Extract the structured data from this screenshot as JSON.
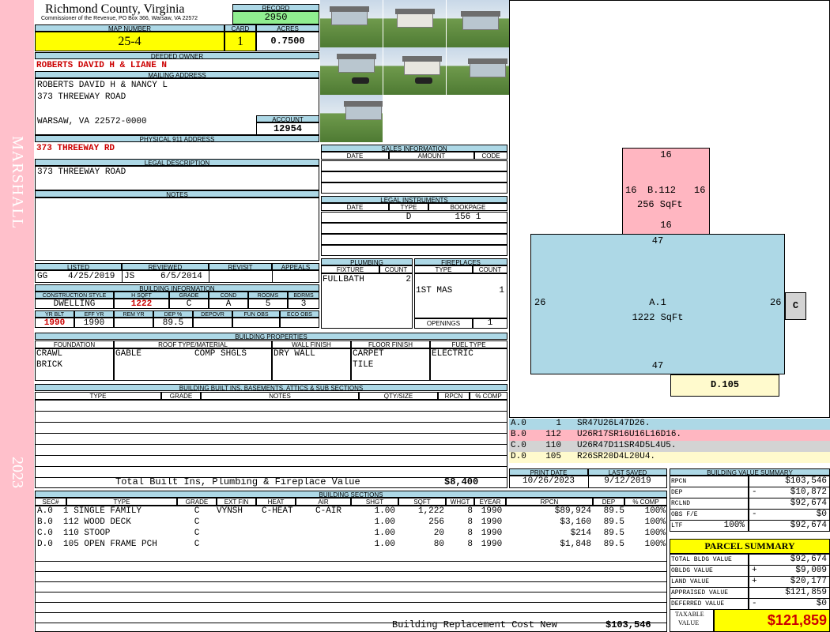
{
  "sidebar": {
    "district": "MARSHALL",
    "year": "2023"
  },
  "header": {
    "county": "Richmond County, Virginia",
    "commissioner": "Commissioner of the Revenue, PO Box 366, Warsaw, VA 22572",
    "record_label": "RECORD",
    "record": "2950",
    "map_label": "MAP NUMBER",
    "map_number": "25-4",
    "card_label": "CARD",
    "card": "1",
    "acres_label": "ACRES",
    "acres": "0.7500"
  },
  "owner": {
    "deeded_label": "DEEDED OWNER",
    "deeded": "ROBERTS DAVID H & LIANE N",
    "mailing_label": "MAILING ADDRESS",
    "mail1": "ROBERTS DAVID H & NANCY L",
    "mail2": "373 THREEWAY ROAD",
    "mail3": "WARSAW, VA 22572-0000",
    "account_label": "ACCOUNT",
    "account": "12954",
    "addr911_label": "PHYSICAL 911 ADDRESS",
    "addr911": "373 THREEWAY RD",
    "legal_label": "LEGAL DESCRIPTION",
    "legal": "373 THREEWAY ROAD",
    "notes_label": "NOTES"
  },
  "review": {
    "listed_label": "LISTED",
    "reviewed_label": "REVIEWED",
    "revisit_label": "REVISIT",
    "appeals_label": "APPEALS",
    "listed_by": "GG",
    "listed_date": "4/25/2019",
    "reviewed_by": "JS",
    "reviewed_date": "6/5/2014"
  },
  "building_info": {
    "title": "BUILDING INFORMATION",
    "h": [
      "CONSTRUCTION STYLE",
      "H SQFT",
      "GRADE",
      "COND",
      "ROOMS",
      "BDRMS"
    ],
    "v": [
      "DWELLING",
      "1222",
      "C",
      "A",
      "5",
      "3"
    ],
    "h2": [
      "YR BLT",
      "EFF YR",
      "REM YR",
      "DEP %",
      "DEPOVR",
      "FUN OBS",
      "ECO OBS"
    ],
    "v2": [
      "1990",
      "1990",
      "",
      "89.5",
      "",
      "",
      ""
    ]
  },
  "sales": {
    "title": "SALES INFORMATION",
    "h": [
      "DATE",
      "AMOUNT",
      "CODE"
    ]
  },
  "legal_inst": {
    "title": "LEGAL INSTRUMENTS",
    "h": [
      "DATE",
      "TYPE",
      "BOOKPAGE"
    ],
    "type": "D",
    "bookpage": "156 1"
  },
  "plumbing": {
    "title": "PLUMBING",
    "h": [
      "FIXTURE",
      "COUNT"
    ],
    "fixture": "FULLBATH",
    "count": "2"
  },
  "fireplaces": {
    "title": "FIREPLACES",
    "h": [
      "TYPE",
      "COUNT"
    ],
    "type": "1ST MAS",
    "count": "1",
    "openings_label": "OPENINGS",
    "openings": "1"
  },
  "props": {
    "title": "BUILDING PROPERTIES",
    "h": [
      "FOUNDATION",
      "ROOF TYPE/MATERIAL",
      "WALL FINISH",
      "FLOOR FINISH",
      "FUEL TYPE"
    ],
    "f1": "CRAWL",
    "f2": "BRICK",
    "roof1": "GABLE",
    "roof2": "COMP SHGLS",
    "wall": "DRY WALL",
    "fl1": "CARPET",
    "fl2": "TILE",
    "fuel": "ELECTRIC"
  },
  "builtins": {
    "title": "BUILDING BUILT INS, BASEMENTS, ATTICS & SUB SECTIONS",
    "h": [
      "TYPE",
      "GRADE",
      "NOTES",
      "QTY/SIZE",
      "RPCN",
      "% COMP"
    ],
    "total_label": "Total Built Ins, Plumbing & Fireplace Value",
    "total": "$8,400"
  },
  "print": {
    "print_label": "PRINT DATE",
    "saved_label": "LAST SAVED",
    "print_date": "10/26/2023",
    "saved_date": "9/12/2019"
  },
  "sections": {
    "title": "BUILDING SECTIONS",
    "h": [
      "SEC#",
      "TYPE",
      "GRADE",
      "EXT FIN",
      "HEAT",
      "AIR",
      "SHGT",
      "SQFT",
      "WHGT",
      "EYEAR",
      "RPCN",
      "DEP",
      "% COMP"
    ],
    "rows": [
      [
        "A.0",
        "1 SINGLE FAMILY",
        "C",
        "VYNSH",
        "C-HEAT",
        "C-AIR",
        "1.00",
        "1,222",
        "8",
        "1990",
        "$89,924",
        "89.5",
        "100%"
      ],
      [
        "B.0",
        "112 WOOD DECK",
        "C",
        "",
        "",
        "",
        "1.00",
        "256",
        "8",
        "1990",
        "$3,160",
        "89.5",
        "100%"
      ],
      [
        "C.0",
        "110 STOOP",
        "C",
        "",
        "",
        "",
        "1.00",
        "20",
        "8",
        "1990",
        "$214",
        "89.5",
        "100%"
      ],
      [
        "D.0",
        "105 OPEN FRAME PCH",
        "C",
        "",
        "",
        "",
        "1.00",
        "80",
        "8",
        "1990",
        "$1,848",
        "89.5",
        "100%"
      ]
    ],
    "cost_label": "Building Replacement Cost New",
    "cost": "$103,546"
  },
  "sketch": {
    "b_top": "16",
    "b_left": "16",
    "b_right": "16",
    "b_bottom": "16",
    "b_name": "B.112",
    "b_area": "256 SqFt",
    "a_top": "47",
    "a_left": "26",
    "a_right": "26",
    "a_bottom": "47",
    "a_name": "A.1",
    "a_area": "1222 SqFt",
    "c_name": "C",
    "d_name": "D.105",
    "legend": [
      {
        "code": "A.0",
        "num": "1",
        "path": "SR47U26L47D26.",
        "color": "#add8e6"
      },
      {
        "code": "B.0",
        "num": "112",
        "path": "U26R17SR16U16L16D16.",
        "color": "#ffb6c1"
      },
      {
        "code": "C.0",
        "num": "110",
        "path": "U26R47D11SR4D5L4U5.",
        "color": "#d3d3d3"
      },
      {
        "code": "D.0",
        "num": "105",
        "path": "R26SR20D4L20U4.",
        "color": "#fffacd"
      }
    ]
  },
  "value_summary": {
    "title": "BUILDING VALUE SUMMARY",
    "rows": [
      {
        "l": "RPCN",
        "s": "",
        "v": "$103,546"
      },
      {
        "l": "DEP",
        "s": "-",
        "v": "$10,872"
      },
      {
        "l": "RCLND",
        "s": "",
        "v": "$92,674"
      },
      {
        "l": "OBS F/E",
        "s": "-",
        "v": "$0"
      },
      {
        "l": "LTF",
        "s": "100%",
        "v": "$92,674"
      }
    ]
  },
  "parcel": {
    "title": "PARCEL SUMMARY",
    "rows": [
      {
        "l": "TOTAL BLDG VALUE",
        "s": "",
        "v": "$92,674"
      },
      {
        "l": "OBLDG VALUE",
        "s": "+",
        "v": "$9,009"
      },
      {
        "l": "LAND VALUE",
        "s": "+",
        "v": "$20,177"
      },
      {
        "l": "APPRAISED VALUE",
        "s": "",
        "v": "$121,859"
      },
      {
        "l": "DEFERRED VALUE",
        "s": "-",
        "v": "$0"
      }
    ],
    "taxable_label1": "TAXABLE",
    "taxable_label2": "VALUE",
    "taxable": "$121,859"
  }
}
